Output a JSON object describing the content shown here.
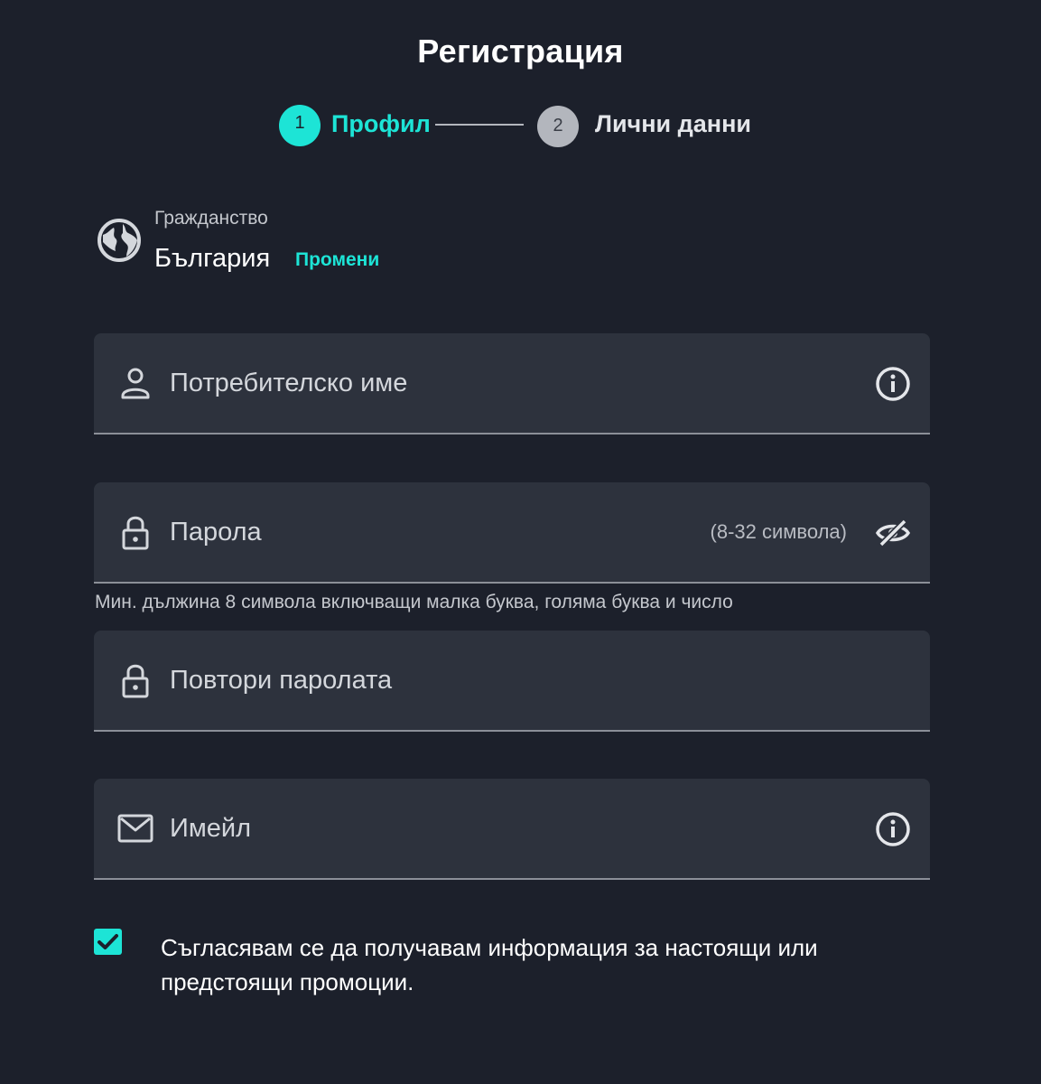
{
  "page": {
    "title": "Регистрация"
  },
  "stepper": {
    "step1": {
      "number": "1",
      "label": "Профил"
    },
    "step2": {
      "number": "2",
      "label": "Лични данни"
    }
  },
  "citizenship": {
    "label": "Гражданство",
    "value": "България",
    "change_label": "Промени",
    "icon": "globe-icon"
  },
  "fields": {
    "username": {
      "placeholder": "Потребителско име",
      "value": "",
      "icon": "user-icon",
      "right_icon": "info-icon"
    },
    "password": {
      "placeholder": "Парола",
      "value": "",
      "hint": "(8-32 символа)",
      "icon": "lock-icon",
      "right_icon": "eye-off-icon"
    },
    "password_helper": "Мин. дължина 8 символа включващи малка буква, голяма буква и число",
    "repeat_password": {
      "placeholder": "Повтори паролата",
      "value": "",
      "icon": "lock-icon"
    },
    "email": {
      "placeholder": "Имейл",
      "value": "",
      "icon": "mail-icon",
      "right_icon": "info-icon"
    }
  },
  "consent": {
    "checked": true,
    "text": "Съгласявам се да получавам информация за настоящи или предстоящи промоции."
  },
  "colors": {
    "background": "#1c202b",
    "field_background": "#2d323d",
    "accent": "#1de4d6",
    "inactive_step": "#b3b6bd"
  }
}
